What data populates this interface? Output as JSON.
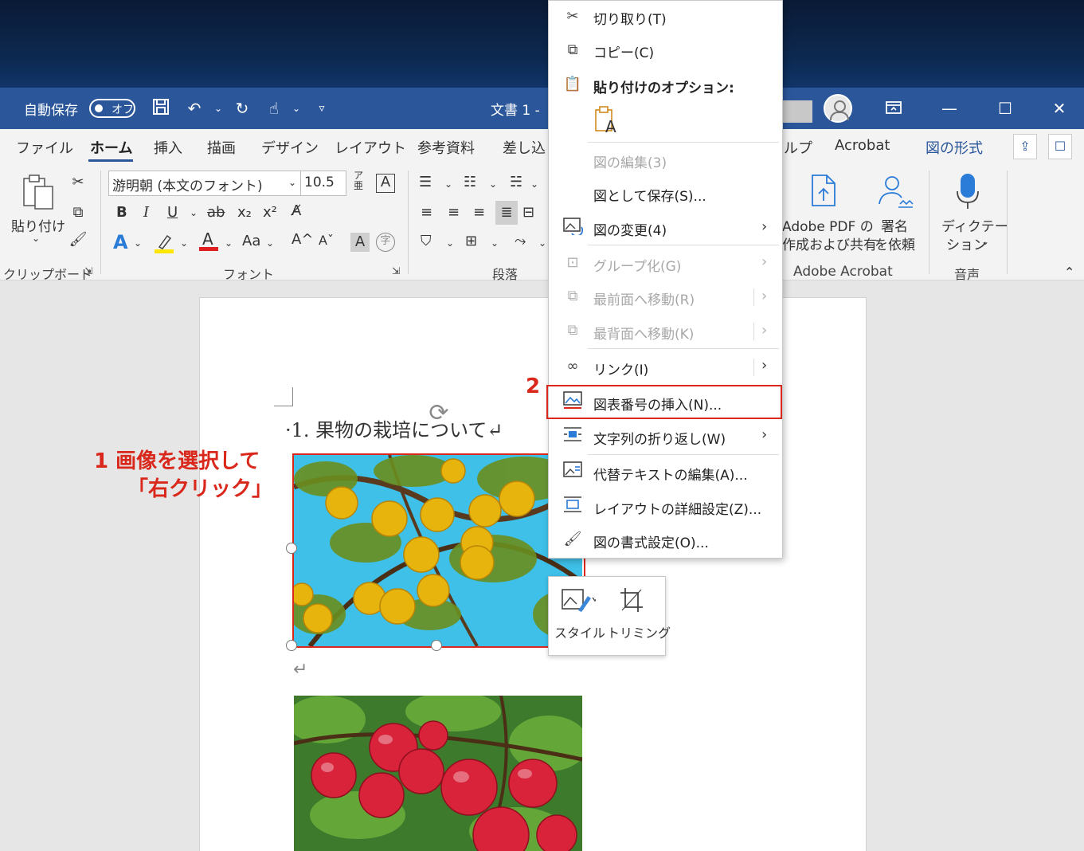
{
  "titlebar": {
    "autosave_label": "自動保存",
    "autosave_state": "オフ",
    "doc_title": "文書 1  -"
  },
  "tabs": [
    "ファイル",
    "ホーム",
    "挿入",
    "描画",
    "デザイン",
    "レイアウト",
    "参考資料",
    "差し込",
    "ルプ",
    "Acrobat",
    "図の形式"
  ],
  "ribbon": {
    "paste_label": "貼り付け",
    "clipboard_group": "クリップボード",
    "font_name": "游明朝 (本文のフォント)",
    "font_size": "10.5",
    "font_group": "フォント",
    "paragraph_group": "段落",
    "acrobat_create_line1": "Adobe PDF の",
    "acrobat_create_line2": "作成および共有",
    "acrobat_sign_line1": "署名",
    "acrobat_sign_line2": "を依頼",
    "acrobat_group": "Adobe Acrobat",
    "dictate_line1": "ディクテー",
    "dictate_line2": "ション",
    "voice_group": "音声"
  },
  "document": {
    "heading": "·1. 果物の栽培について↵",
    "para_mark": "↵"
  },
  "annotations": {
    "step1_line1": "1 画像を選択して",
    "step1_line2": "「右クリック」",
    "step2": "2"
  },
  "context_menu": {
    "cut": "切り取り(T)",
    "copy": "コピー(C)",
    "paste_options": "貼り付けのオプション:",
    "edit_picture": "図の編集(3)",
    "save_as_picture": "図として保存(S)...",
    "change_picture": "図の変更(4)",
    "group": "グループ化(G)",
    "bring_front": "最前面へ移動(R)",
    "send_back": "最背面へ移動(K)",
    "link": "リンク(I)",
    "insert_caption": "図表番号の挿入(N)...",
    "wrap_text": "文字列の折り返し(W)",
    "edit_alt_text": "代替テキストの編集(A)...",
    "layout_options": "レイアウトの詳細設定(Z)...",
    "format_picture": "図の書式設定(O)..."
  },
  "mini_toolbar": {
    "style": "スタイル",
    "crop": "トリミング"
  },
  "colors": {
    "word_blue": "#2b579a",
    "annotation_red": "#d9281b"
  }
}
